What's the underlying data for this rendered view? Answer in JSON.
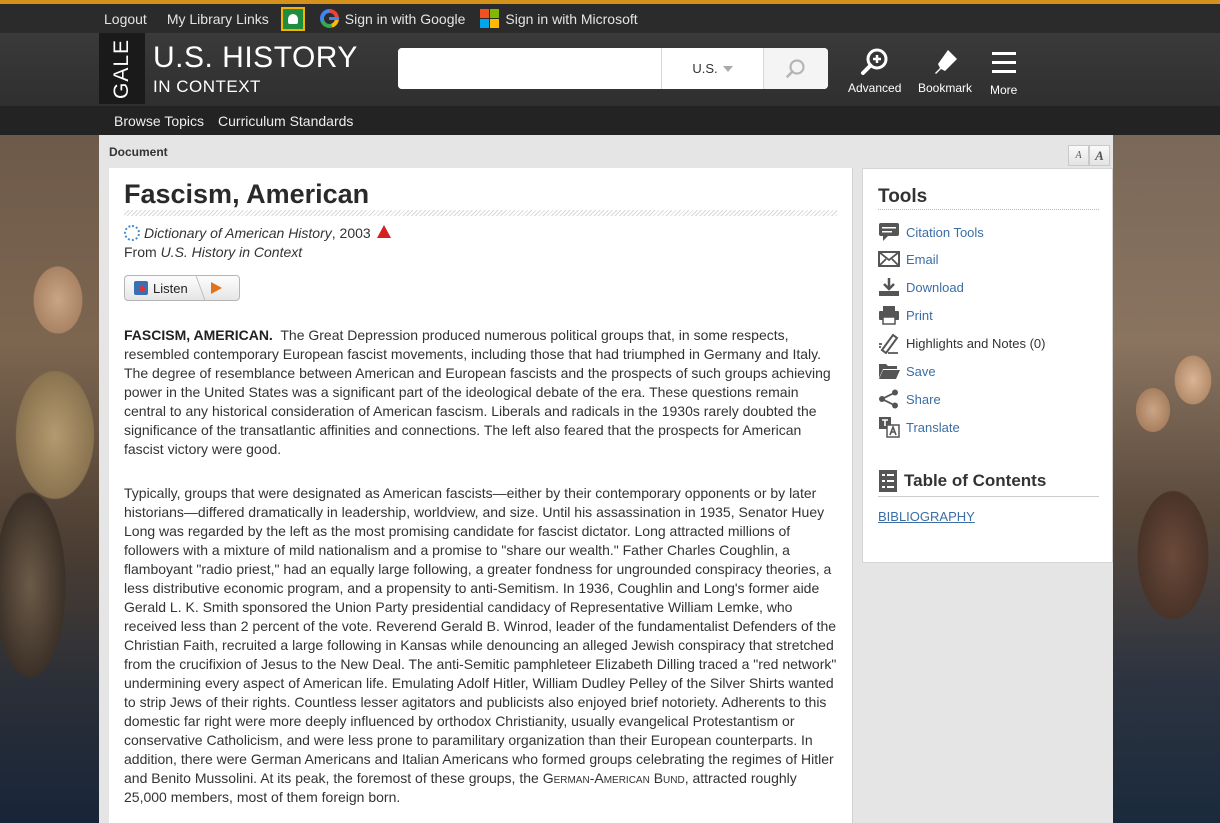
{
  "topbar": {
    "logout": "Logout",
    "library_links": "My Library Links",
    "google_signin": "Sign in with Google",
    "microsoft_signin": "Sign in with Microsoft"
  },
  "header": {
    "gale": "GALE",
    "title": "U.S. HISTORY",
    "subtitle": "IN CONTEXT",
    "search_value": "",
    "search_scope": "U.S.",
    "advanced": "Advanced",
    "bookmark": "Bookmark",
    "more": "More"
  },
  "subnav": {
    "browse_topics": "Browse Topics",
    "curriculum_standards": "Curriculum Standards"
  },
  "document": {
    "label": "Document",
    "font_small": "A",
    "font_large": "A",
    "title": "Fascism, American",
    "source_title": "Dictionary of American History",
    "source_year": ", 2003",
    "from_prefix": "From ",
    "from_source": "U.S. History in Context",
    "listen": "Listen",
    "lead": "FASCISM, AMERICAN.",
    "p1": "The Great Depression produced numerous political groups that, in some respects, resembled contemporary European fascist movements, including those that had triumphed in Germany and Italy. The degree of resemblance between American and European fascists and the prospects of such groups achieving power in the United States was a significant part of the ideological debate of the era. These questions remain central to any historical consideration of American fascism. Liberals and radicals in the 1930s rarely doubted the significance of the transatlantic affinities and connections. The left also feared that the prospects for American fascist victory were good.",
    "p2_main": "Typically, groups that were designated as American fascists—either by their contemporary opponents or by later historians—differed dramatically in leadership, worldview, and size. Until his assassination in 1935, Senator Huey Long was regarded by the left as the most promising candidate for fascist dictator. Long attracted millions of followers with a mixture of mild nationalism and a promise to \"share our wealth.\" Father Charles Coughlin, a flamboyant \"radio priest,\" had an equally large following, a greater fondness for ungrounded conspiracy theories, a less distributive economic program, and a propensity to anti-Semitism. In 1936, Coughlin and Long's former aide Gerald L. K. Smith sponsored the Union Party presidential candidacy of Representative William Lemke, who received less than 2 percent of the vote. Reverend Gerald B. Winrod, leader of the fundamentalist Defenders of the Christian Faith, recruited a large following in Kansas while denouncing an alleged Jewish conspiracy that stretched from the crucifixion of Jesus to the New Deal. The anti-Semitic pamphleteer Elizabeth Dilling traced a \"red network\" undermining every aspect of American life. Emulating Adolf Hitler, William Dudley Pelley of the Silver Shirts wanted to strip Jews of their rights. Countless lesser agitators and publicists also enjoyed brief notoriety. Adherents to this domestic far right were more deeply influenced by orthodox Christianity, usually evangelical Protestantism or conservative Catholicism, and were less prone to paramilitary organization than their European counterparts. In addition, there were German Americans and Italian Americans who formed groups celebrating the regimes of Hitler and Benito Mussolini. At its peak, the foremost of these groups, the ",
    "p2_sc": "German-American Bund",
    "p2_end": ", attracted roughly 25,000 members, most of them foreign born."
  },
  "tools": {
    "title": "Tools",
    "items": [
      {
        "label": "Citation Tools",
        "icon": "citation-icon"
      },
      {
        "label": "Email",
        "icon": "email-icon"
      },
      {
        "label": "Download",
        "icon": "download-icon"
      },
      {
        "label": "Print",
        "icon": "print-icon"
      },
      {
        "label": "Highlights and Notes (0)",
        "icon": "highlight-icon"
      },
      {
        "label": "Save",
        "icon": "folder-icon"
      },
      {
        "label": "Share",
        "icon": "share-icon"
      },
      {
        "label": "Translate",
        "icon": "translate-icon"
      }
    ],
    "toc_title": "Table of Contents",
    "toc_link": "BIBLIOGRAPHY"
  },
  "colors": {
    "accent_bar": "#d4911c",
    "link": "#3a6ea5",
    "alert_triangle": "#d42020",
    "play": "#e0731c"
  }
}
